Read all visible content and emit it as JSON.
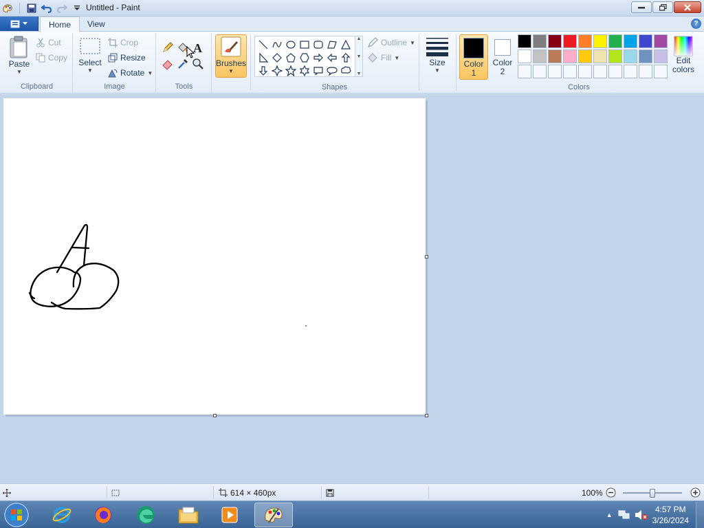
{
  "window": {
    "title": "Untitled - Paint"
  },
  "tabs": [
    {
      "label": "Home",
      "active": true
    },
    {
      "label": "View",
      "active": false
    }
  ],
  "ribbon": {
    "clipboard": {
      "label": "Clipboard",
      "paste": "Paste",
      "cut": "Cut",
      "copy": "Copy"
    },
    "image": {
      "label": "Image",
      "select": "Select",
      "crop": "Crop",
      "resize": "Resize",
      "rotate": "Rotate"
    },
    "tools": {
      "label": "Tools",
      "items": [
        "pencil-icon",
        "fill-icon",
        "text-icon",
        "eraser-icon",
        "color-picker-icon",
        "magnifier-icon"
      ]
    },
    "brushes": {
      "label": "Brushes"
    },
    "shapes": {
      "label": "Shapes",
      "outline": "Outline",
      "fill": "Fill",
      "items": [
        "line",
        "curve",
        "oval",
        "rectangle",
        "rounded-rectangle",
        "polygon",
        "triangle",
        "right-triangle",
        "diamond",
        "pentagon",
        "hexagon",
        "right-arrow",
        "left-arrow",
        "up-arrow",
        "down-arrow",
        "four-point-star",
        "five-point-star",
        "six-point-star",
        "rounded-callout",
        "oval-callout",
        "cloud-callout"
      ]
    },
    "size": {
      "label": "Size"
    },
    "colors": {
      "label": "Colors",
      "color1_label": "Color",
      "color1_num": "1",
      "color1_value": "#000000",
      "color2_label": "Color",
      "color2_num": "2",
      "color2_value": "#ffffff",
      "edit_label_1": "Edit",
      "edit_label_2": "colors",
      "palette": [
        "#000000",
        "#7f7f7f",
        "#880015",
        "#ed1c24",
        "#ff7f27",
        "#fff200",
        "#22b14c",
        "#00a2e8",
        "#3f48cc",
        "#a349a4",
        "#ffffff",
        "#c3c3c3",
        "#b97a57",
        "#ffaec9",
        "#ffc90e",
        "#efe4b0",
        "#b5e61d",
        "#99d9ea",
        "#7092be",
        "#c8bfe7",
        "#f5f8fc",
        "#f5f8fc",
        "#f5f8fc",
        "#f5f8fc",
        "#f5f8fc",
        "#f5f8fc",
        "#f5f8fc",
        "#f5f8fc",
        "#f5f8fc",
        "#f5f8fc"
      ]
    }
  },
  "status": {
    "canvas_size": "614 × 460px",
    "zoom": "100%",
    "zoom_fraction": 0.5
  },
  "taskbar": {
    "time": "4:57 PM",
    "date": "3/26/2024"
  }
}
